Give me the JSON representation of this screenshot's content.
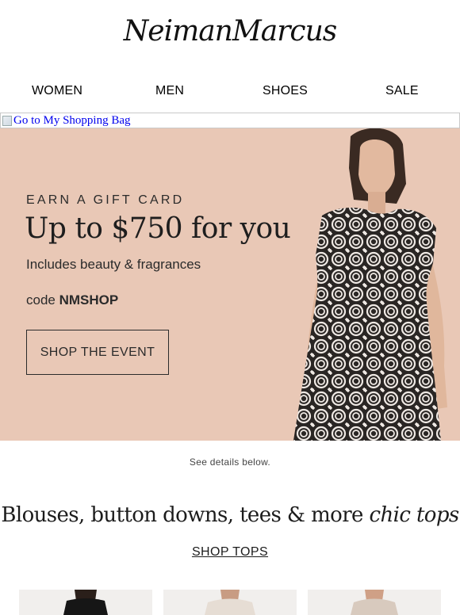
{
  "brand": {
    "logo_text": "NeimanMarcus"
  },
  "nav": {
    "items": [
      "WOMEN",
      "MEN",
      "SHOES",
      "SALE"
    ]
  },
  "bag_link": {
    "alt_text": "Go to My Shopping Bag"
  },
  "hero": {
    "eyebrow": "EARN A GIFT CARD",
    "headline": "Up to $750 for you",
    "subline": "Includes beauty & fragrances",
    "code_prefix": "code",
    "code_value": "NMSHOP",
    "cta_label": "SHOP THE EVENT",
    "background_color": "#e9c8b6"
  },
  "details_note": "See details below.",
  "tops_section": {
    "heading_plain": "Blouses, button downs, tees & more",
    "heading_italic": "chic tops",
    "link_label": "SHOP TOPS"
  }
}
